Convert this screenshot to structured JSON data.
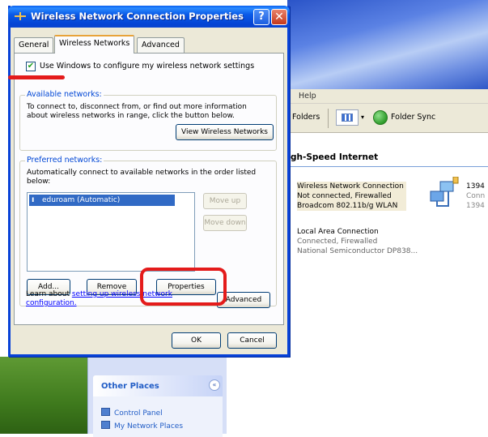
{
  "dialog": {
    "title": "Wireless Network Connection Properties",
    "help_button": "?",
    "close_button": "✕",
    "tabs": [
      {
        "label": "General"
      },
      {
        "label": "Wireless Networks"
      },
      {
        "label": "Advanced"
      }
    ],
    "use_windows_checkbox": {
      "label": "Use Windows to configure my wireless network settings",
      "checked": true
    },
    "available_networks": {
      "legend": "Available networks:",
      "text": "To connect to, disconnect from, or find out more information about wireless networks in range, click the button below.",
      "view_button": "View Wireless Networks"
    },
    "preferred_networks": {
      "legend": "Preferred networks:",
      "text": "Automatically connect to available networks in the order listed below:",
      "items": [
        "eduroam (Automatic)"
      ],
      "move_up": "Move up",
      "move_down": "Move down",
      "add": "Add...",
      "remove": "Remove",
      "properties": "Properties"
    },
    "learn_prefix": "Learn about ",
    "learn_link": "setting up wireless network configuration.",
    "advanced_button": "Advanced",
    "ok": "OK",
    "cancel": "Cancel"
  },
  "explorer": {
    "menu_help": "Help",
    "toolbar": {
      "folders": "Folders",
      "views_arrow": "▾",
      "folder_sync": "Folder Sync"
    },
    "section_title": "gh-Speed Internet",
    "connections": [
      {
        "name": "Wireless Network Connection",
        "status": "Not connected, Firewalled",
        "device": "Broadcom 802.11b/g WLAN"
      },
      {
        "name": "Local Area Connection",
        "status": "Connected, Firewalled",
        "device": "National Semiconductor DP838..."
      }
    ],
    "side_item": {
      "name": "1394",
      "line2": "Conn",
      "line3": "1394"
    }
  },
  "other_places": {
    "title": "Other Places",
    "toggle": "«",
    "links": [
      "Control Panel",
      "My Network Places"
    ]
  },
  "colors": {
    "title_blue": "#0a5ae8",
    "annotation_red": "#e41b1b",
    "dialog_face": "#ece9d8"
  }
}
